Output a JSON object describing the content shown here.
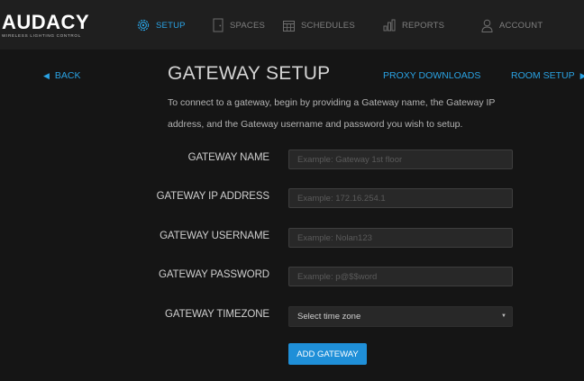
{
  "brand": {
    "name": "AUDACY",
    "tagline": "WIRELESS LIGHTING CONTROL"
  },
  "nav": {
    "items": [
      {
        "label": "SETUP",
        "icon": "gear-icon",
        "active": true
      },
      {
        "label": "SPACES",
        "icon": "door-icon",
        "active": false
      },
      {
        "label": "SCHEDULES",
        "icon": "calendar-icon",
        "active": false
      },
      {
        "label": "REPORTS",
        "icon": "bar-chart-icon",
        "active": false
      },
      {
        "label": "ACCOUNT",
        "icon": "user-icon",
        "active": false
      }
    ]
  },
  "header": {
    "back": "BACK",
    "title": "GATEWAY SETUP",
    "proxy_downloads": "PROXY DOWNLOADS",
    "room_setup": "ROOM SETUP"
  },
  "intro_text": "To connect to a gateway, begin by providing a Gateway name, the Gateway IP address, and the Gateway username and password you wish to setup.",
  "form": {
    "name": {
      "label": "GATEWAY NAME",
      "placeholder": "Example: Gateway 1st floor",
      "value": ""
    },
    "ip": {
      "label": "GATEWAY IP ADDRESS",
      "placeholder": "Example: 172.16.254.1",
      "value": ""
    },
    "username": {
      "label": "GATEWAY USERNAME",
      "placeholder": "Example: Nolan123",
      "value": ""
    },
    "password": {
      "label": "GATEWAY PASSWORD",
      "placeholder": "Example: p@$$word",
      "value": ""
    },
    "timezone": {
      "label": "GATEWAY TIMEZONE",
      "selected": "Select time zone"
    },
    "submit_label": "ADD GATEWAY"
  },
  "colors": {
    "accent": "#2aa3e4",
    "button": "#1f8fd8",
    "background": "#151515",
    "topbar": "#1f1f1f"
  }
}
